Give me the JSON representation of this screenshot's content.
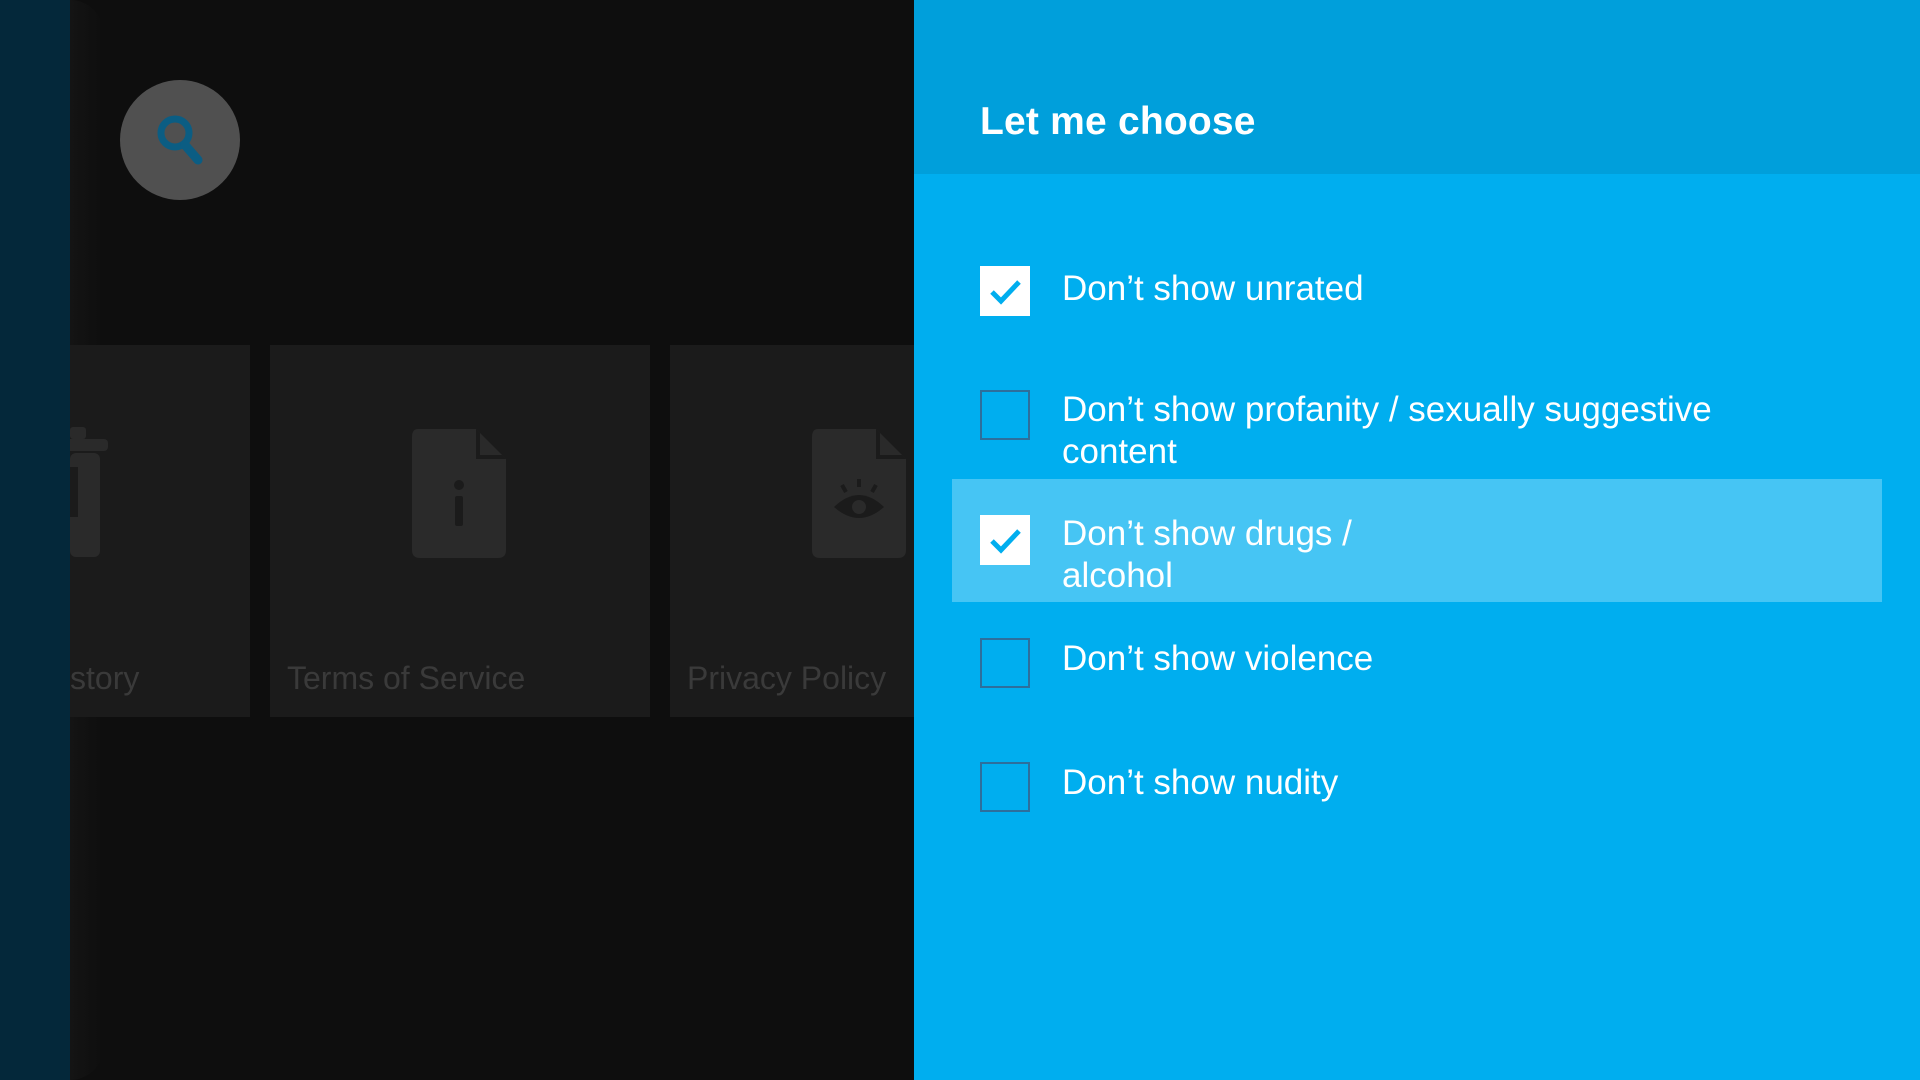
{
  "background": {
    "cards": [
      {
        "label": "story",
        "icon": "trash-icon"
      },
      {
        "label": "Terms of Service",
        "icon": "info-document-icon"
      },
      {
        "label": "Privacy Policy",
        "icon": "eye-document-icon"
      }
    ],
    "search_icon": "search-icon"
  },
  "dialog": {
    "title": "Let me choose",
    "options": [
      {
        "label": "Don’t show unrated",
        "checked": true
      },
      {
        "label": "Don’t show profanity / sexually suggestive content",
        "checked": false
      },
      {
        "label": "Don’t show drugs / alcohol",
        "checked": true
      },
      {
        "label": "Don’t show violence",
        "checked": false
      },
      {
        "label": "Don’t show nudity",
        "checked": false
      }
    ]
  },
  "colors": {
    "panel": "#00aeef",
    "header": "#009fdb",
    "focused_row": "#46c5f4",
    "rail": "#04283a"
  }
}
